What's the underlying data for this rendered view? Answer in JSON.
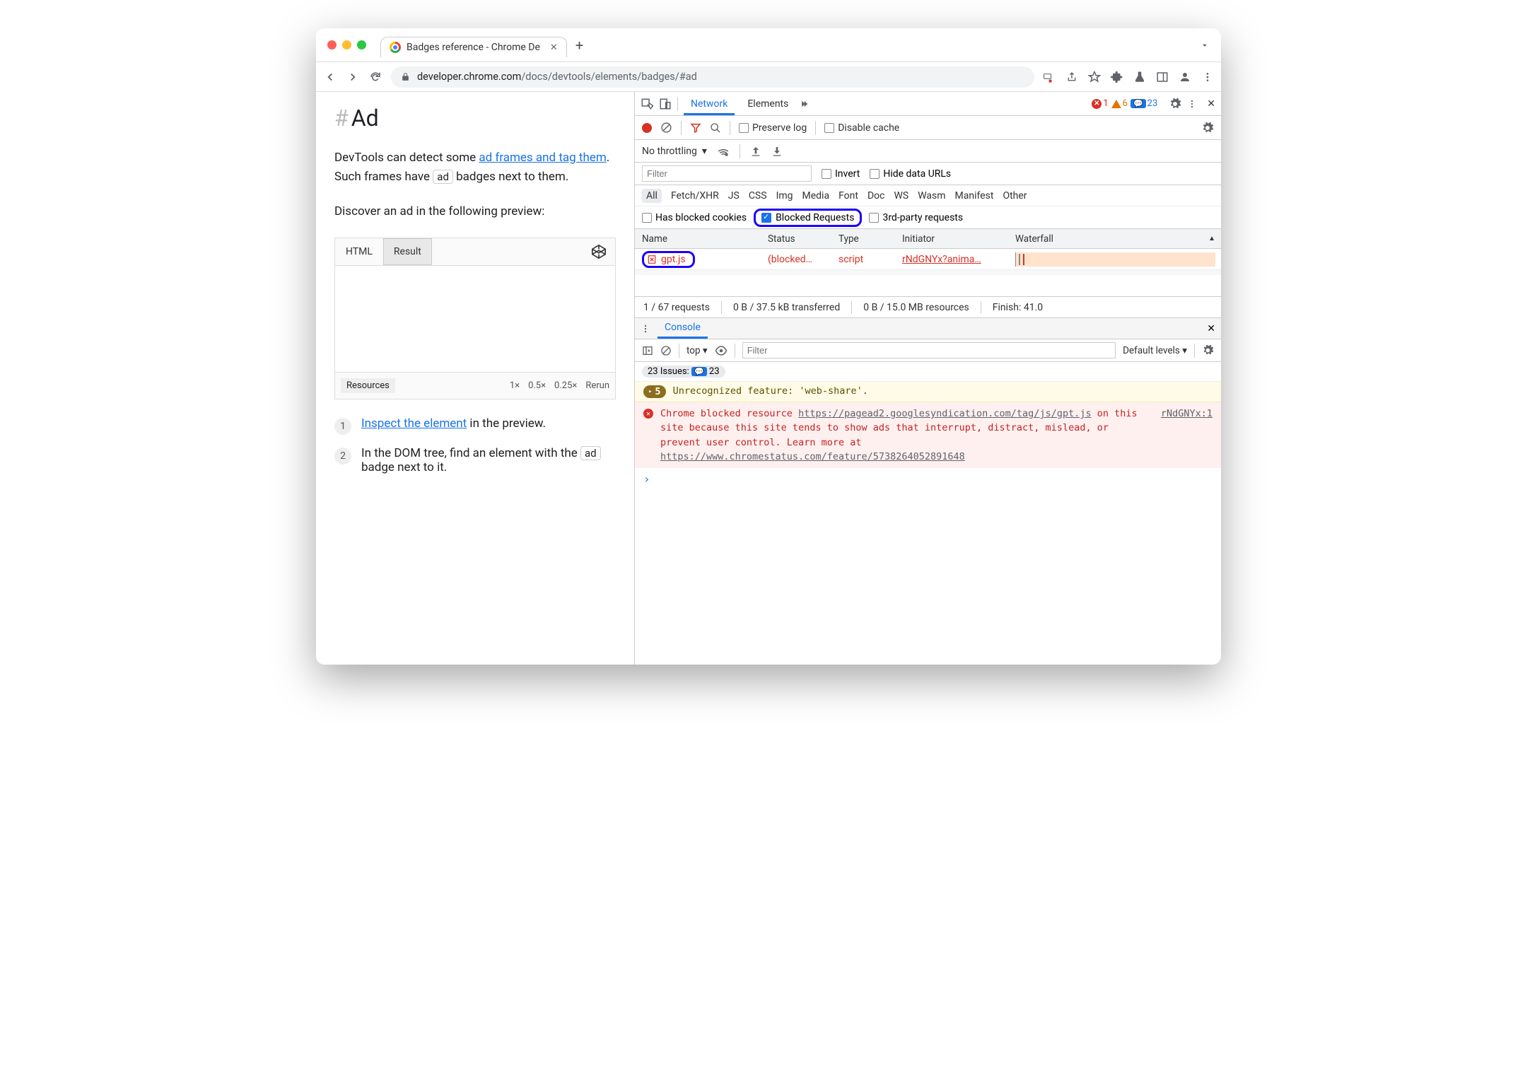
{
  "browser": {
    "tab_title": "Badges reference - Chrome De",
    "url_display": "developer.chrome.com/docs/devtools/elements/badges/#ad",
    "url_domain": "developer.chrome.com"
  },
  "page": {
    "heading": "Ad",
    "para1_pre": "DevTools can detect some ",
    "para1_link": "ad frames and tag them",
    "para1_mid": ". Such frames have ",
    "para1_badge": "ad",
    "para1_post": " badges next to them.",
    "para2": "Discover an ad in the following preview:",
    "codepen": {
      "tab_html": "HTML",
      "tab_result": "Result",
      "footer_resources": "Resources",
      "zoom_1": "1×",
      "zoom_05": "0.5×",
      "zoom_025": "0.25×",
      "rerun": "Rerun"
    },
    "steps": {
      "s1_num": "1",
      "s1_link": "Inspect the element",
      "s1_rest": " in the preview.",
      "s2_num": "2",
      "s2_pre": "In the DOM tree, find an element with the ",
      "s2_badge": "ad",
      "s2_post": " badge next to it."
    }
  },
  "devtools": {
    "tabs": {
      "network": "Network",
      "elements": "Elements"
    },
    "counts": {
      "errors": "1",
      "warnings": "6",
      "messages": "23"
    },
    "network": {
      "preserve_log": "Preserve log",
      "disable_cache": "Disable cache",
      "no_throttling": "No throttling",
      "filter_placeholder": "Filter",
      "invert": "Invert",
      "hide_urls": "Hide data URLs",
      "types": {
        "all": "All",
        "fetch": "Fetch/XHR",
        "js": "JS",
        "css": "CSS",
        "img": "Img",
        "media": "Media",
        "font": "Font",
        "doc": "Doc",
        "ws": "WS",
        "wasm": "Wasm",
        "manifest": "Manifest",
        "other": "Other"
      },
      "has_blocked_cookies": "Has blocked cookies",
      "blocked_requests": "Blocked Requests",
      "third_party": "3rd-party requests",
      "cols": {
        "name": "Name",
        "status": "Status",
        "type": "Type",
        "initiator": "Initiator",
        "waterfall": "Waterfall"
      },
      "row": {
        "name": "gpt.js",
        "status": "(blocked…",
        "type": "script",
        "initiator": "rNdGNYx?anima…"
      },
      "statusbar": {
        "requests": "1 / 67 requests",
        "transfer": "0 B / 37.5 kB transferred",
        "resources": "0 B / 15.0 MB resources",
        "finish": "Finish: 41.0"
      }
    },
    "console": {
      "tab": "Console",
      "context": "top",
      "filter_placeholder": "Filter",
      "levels": "Default levels",
      "issues_label": "23 Issues:",
      "issues_count": "23",
      "warn_count": "5",
      "warn_text": "Unrecognized feature: 'web-share'.",
      "err_prefix": "Chrome blocked resource ",
      "err_url1": "https://pagead2.googlesyndication.com/tag/js/gpt.js",
      "err_mid": " on this site because this site tends to show ads that interrupt, distract, mislead, or prevent user control. Learn more at ",
      "err_url2": "https://www.chromestatus.com/feature/5738264052891648",
      "err_source": "rNdGNYx:1"
    }
  }
}
